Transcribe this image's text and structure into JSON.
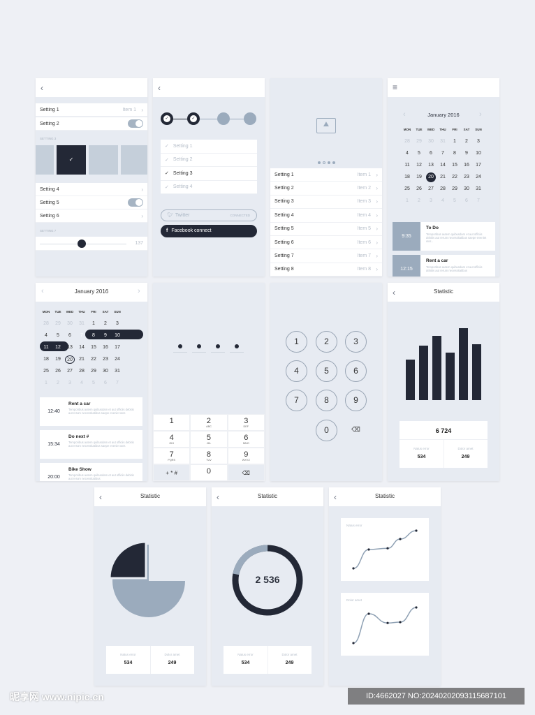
{
  "colors": {
    "background": "#e7ebf2",
    "dark": "#232836",
    "accent_gray": "#9babbd",
    "tile": "#c5cfda"
  },
  "settings_screen": {
    "back_icon": "chevron-left-icon",
    "rows": [
      {
        "label": "Setting 1",
        "value": "Item 1"
      },
      {
        "label": "Setting 2",
        "toggle": true
      },
      {
        "label": "Setting 4"
      },
      {
        "label": "Setting 5",
        "toggle": true
      },
      {
        "label": "Setting 6"
      }
    ],
    "section3": "SETTING 3",
    "section7": "SETTING 7",
    "slider_value": "137",
    "selected_tile": 1
  },
  "onboarding_screen": {
    "steps_total": 4,
    "steps_done": 2,
    "checklist": [
      {
        "label": "Setting 1",
        "checked": false
      },
      {
        "label": "Setting 2",
        "checked": false
      },
      {
        "label": "Setting 3",
        "checked": true
      },
      {
        "label": "Setting 4",
        "checked": false
      }
    ],
    "twitter": "Twitter",
    "twitter_status": "CONNECTED",
    "facebook": "Facebook connect"
  },
  "gallery_screen": {
    "items": [
      {
        "label": "Setting 1",
        "value": "Item 1"
      },
      {
        "label": "Setting 2",
        "value": "Item 2"
      },
      {
        "label": "Setting 3",
        "value": "Item 3"
      },
      {
        "label": "Setting 4",
        "value": "Item 4"
      },
      {
        "label": "Setting 5",
        "value": "Item 5"
      },
      {
        "label": "Setting 6",
        "value": "Item 6"
      },
      {
        "label": "Setting 7",
        "value": "Item 7"
      },
      {
        "label": "Setting 8",
        "value": "Item 8"
      }
    ]
  },
  "calendar": {
    "month": "January 2016",
    "weekdays": [
      "MON",
      "TUE",
      "WED",
      "THU",
      "FRI",
      "SAT",
      "SUN"
    ],
    "days": [
      "28",
      "29",
      "30",
      "31",
      "1",
      "2",
      "3",
      "4",
      "5",
      "6",
      "7",
      "8",
      "9",
      "10",
      "11",
      "12",
      "13",
      "14",
      "15",
      "16",
      "17",
      "18",
      "19",
      "20",
      "21",
      "22",
      "23",
      "24",
      "25",
      "26",
      "27",
      "28",
      "29",
      "30",
      "31",
      "1",
      "2",
      "3",
      "4",
      "5",
      "6",
      "7"
    ],
    "today": "20"
  },
  "calendar_screen": {
    "events": [
      {
        "time": "9:35",
        "title": "To Do",
        "text": "Temporibus autem quibusdam et aut officiis debitis aut rerum necessitatibus saepe eveniet uter..."
      },
      {
        "time": "12:15",
        "title": "Rent a car",
        "text": "Temporibus autem quibusdam et aut officiis debitis aut rerum necessitatibus"
      }
    ]
  },
  "range_calendar_screen": {
    "range": "7–12",
    "events": [
      {
        "time": "12:40",
        "title": "Rent a car",
        "text": "Temporibus autem quibusdam et aut officiis debitis aut rerum necessitatibus saepe eveniet uter."
      },
      {
        "time": "15:34",
        "title": "Do next #",
        "text": "Temporibus autem quibusdam et aut officiis debitis aut rerum necessitatibus saepe eveniet uter."
      },
      {
        "time": "20:00",
        "title": "Bike Show",
        "text": "Temporibus autem quibusdam et aut officiis debitis aut rerum necessitatibus"
      }
    ]
  },
  "pin_screen": {
    "digits_entered": 4,
    "keys": [
      {
        "n": "1",
        "l": ""
      },
      {
        "n": "2",
        "l": "ABC"
      },
      {
        "n": "3",
        "l": "DEF"
      },
      {
        "n": "4",
        "l": "GHI"
      },
      {
        "n": "5",
        "l": "JKL"
      },
      {
        "n": "6",
        "l": "MNO"
      },
      {
        "n": "7",
        "l": "PQRS"
      },
      {
        "n": "8",
        "l": "TUV"
      },
      {
        "n": "9",
        "l": "WXYZ"
      },
      {
        "n": "+ * #",
        "l": ""
      },
      {
        "n": "0",
        "l": ""
      },
      {
        "n": "⌫",
        "l": ""
      }
    ]
  },
  "circle_keypad": {
    "keys": [
      "1",
      "2",
      "3",
      "4",
      "5",
      "6",
      "7",
      "8",
      "9",
      "0",
      "⌫"
    ]
  },
  "statistic": {
    "title": "Statistic",
    "total": "6 724",
    "label1": "Natus error",
    "value1": "534",
    "label2": "Dolor amet",
    "value2": "249",
    "donut_value": "2 536",
    "line_label1": "Natus error",
    "line_label2": "Dolor amet"
  },
  "chart_data": [
    {
      "type": "bar",
      "values": [
        58,
        78,
        92,
        68,
        103,
        80
      ]
    },
    {
      "type": "pie",
      "values": [
        25,
        75
      ]
    },
    {
      "type": "pie",
      "values": [
        22,
        78
      ]
    },
    {
      "type": "line",
      "name": "Natus error",
      "values": [
        0,
        45,
        48,
        70,
        90
      ]
    },
    {
      "type": "line",
      "name": "Dolor amet",
      "values": [
        0,
        70,
        48,
        50,
        85
      ]
    }
  ],
  "watermark": {
    "left": "昵享网 www.nipic.cn",
    "right": "ID:4662027 NO:20240202093115687101"
  }
}
